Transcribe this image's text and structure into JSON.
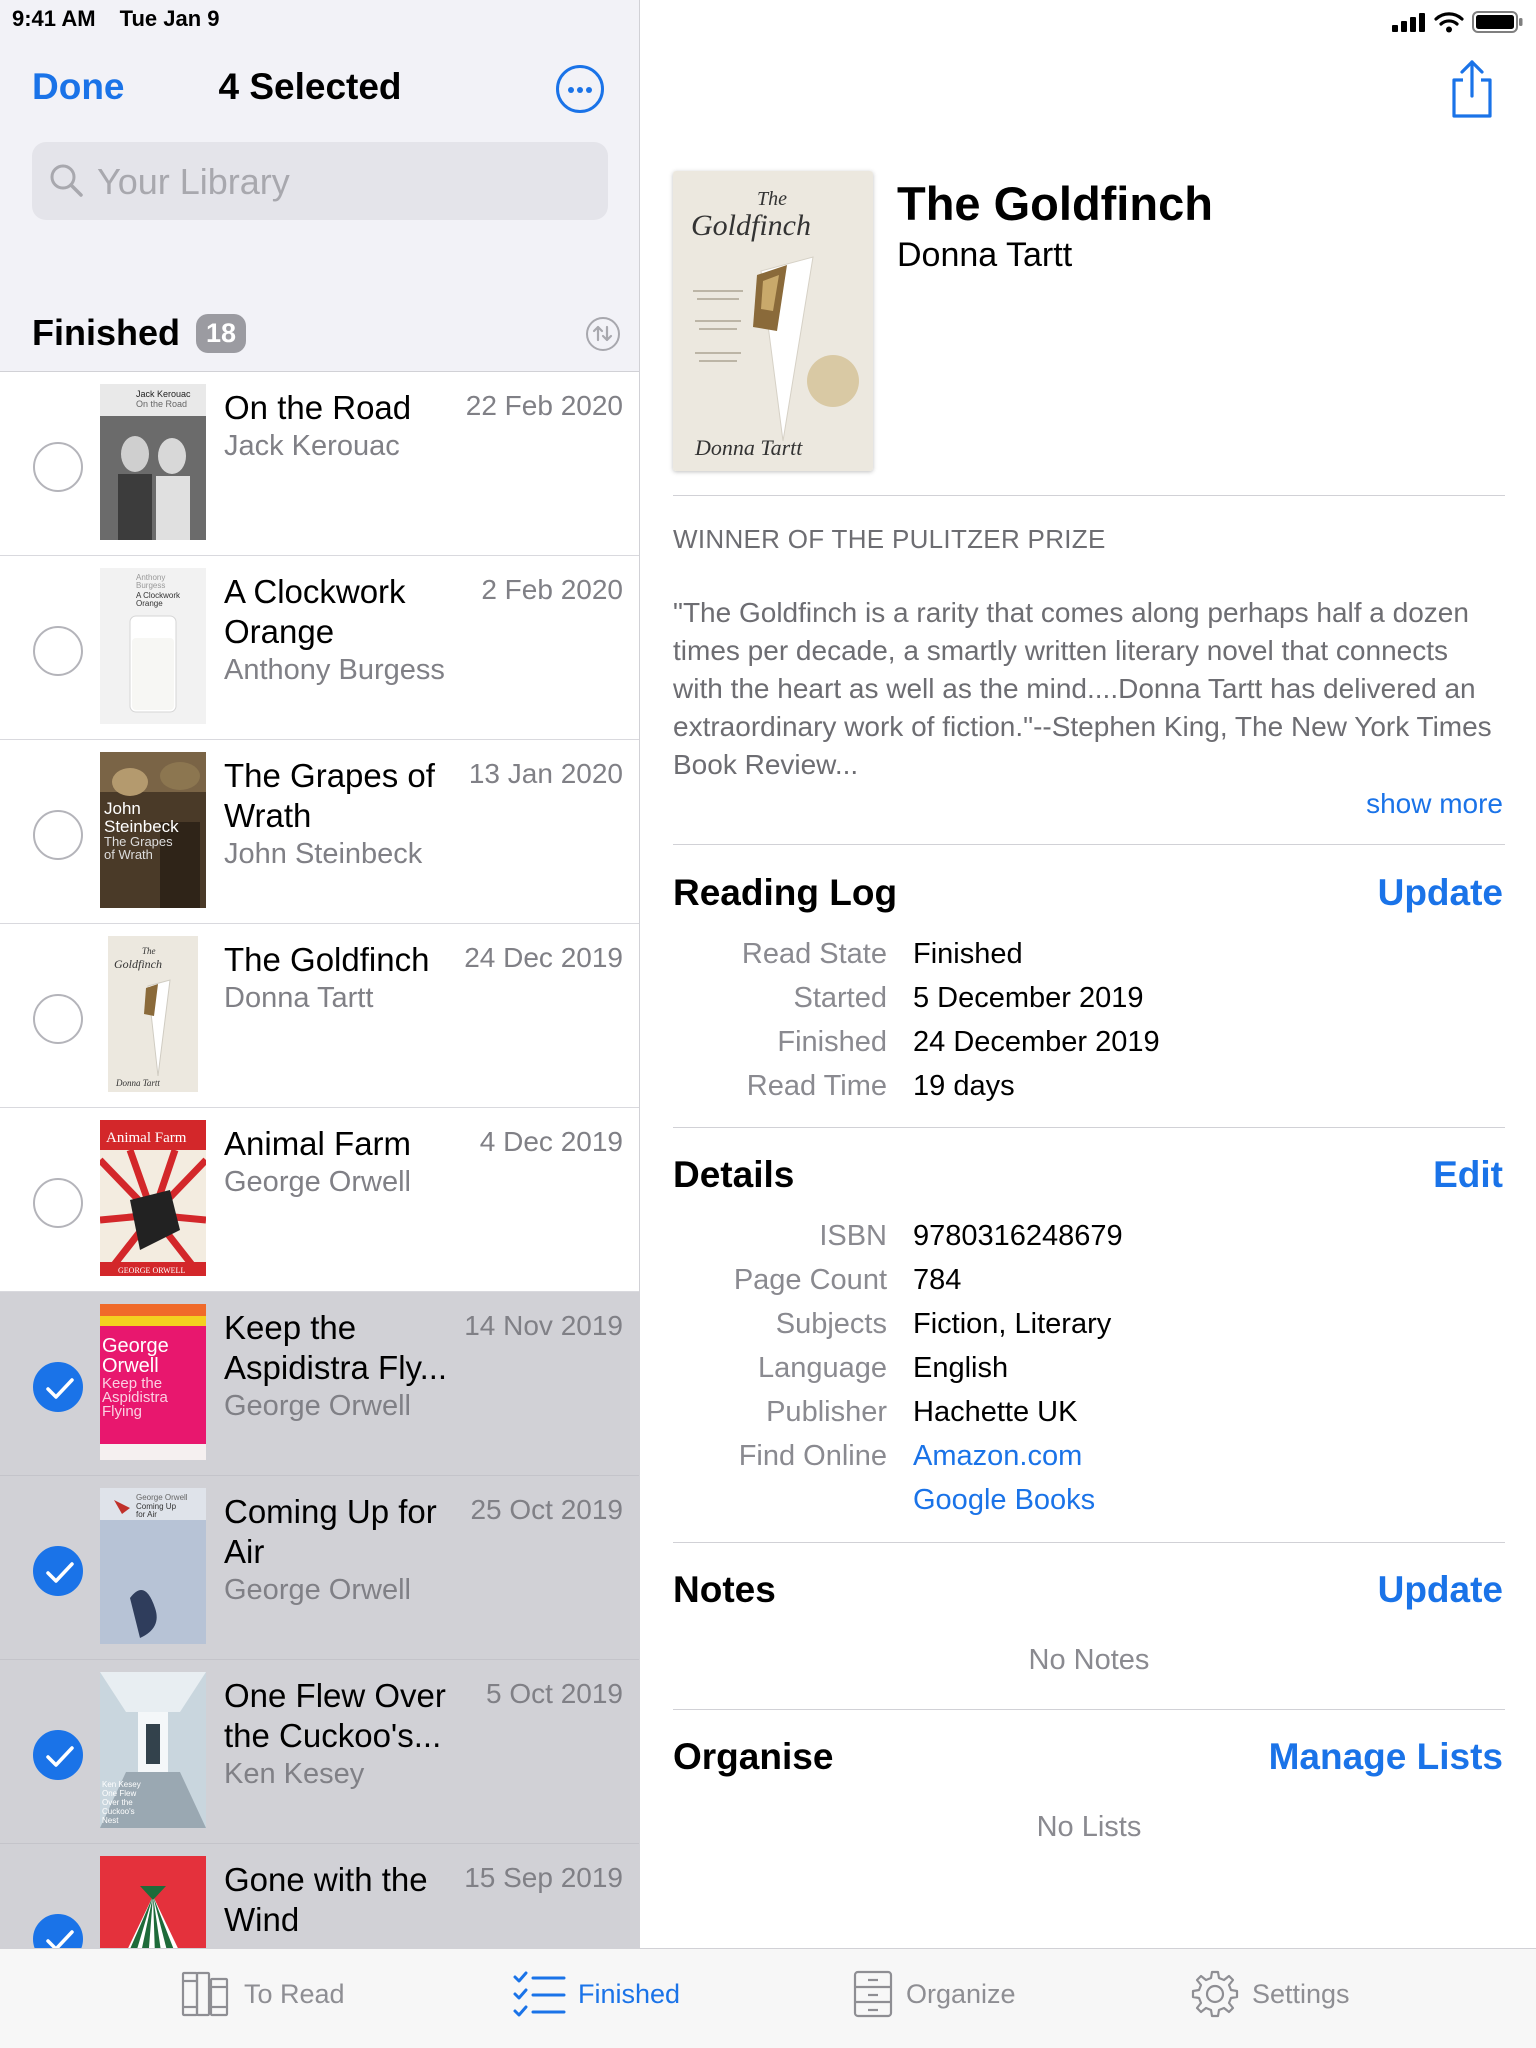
{
  "status": {
    "time": "9:41 AM",
    "date": "Tue Jan 9"
  },
  "nav": {
    "done_label": "Done",
    "title": "4 Selected",
    "more_icon": "ellipsis-circle-icon"
  },
  "search": {
    "placeholder": "Your Library"
  },
  "section": {
    "title": "Finished",
    "count": "18"
  },
  "books": [
    {
      "title": "On the Road",
      "author": "Jack Kerouac",
      "date": "22 Feb 2020",
      "selected": false
    },
    {
      "title": "A Clockwork Orange",
      "author": "Anthony Burgess",
      "date": "2 Feb 2020",
      "selected": false
    },
    {
      "title": "The Grapes of Wrath",
      "author": "John Steinbeck",
      "date": "13 Jan 2020",
      "selected": false
    },
    {
      "title": "The Goldfinch",
      "author": "Donna Tartt",
      "date": "24 Dec 2019",
      "selected": false
    },
    {
      "title": "Animal Farm",
      "author": "George Orwell",
      "date": "4 Dec 2019",
      "selected": false
    },
    {
      "title": "Keep the Aspidistra Fly...",
      "author": "George Orwell",
      "date": "14 Nov 2019",
      "selected": true
    },
    {
      "title": "Coming Up for Air",
      "author": "George Orwell",
      "date": "25 Oct 2019",
      "selected": true
    },
    {
      "title": "One Flew Over the Cuckoo's...",
      "author": "Ken Kesey",
      "date": "5 Oct 2019",
      "selected": true
    },
    {
      "title": "Gone with the Wind",
      "author": "",
      "date": "15 Sep 2019",
      "selected": true
    }
  ],
  "cover_text": {
    "on_the_road": [
      "Jack Kerouac",
      "On the Road"
    ],
    "clockwork": [
      "Anthony",
      "Burgess",
      "A Clockwork",
      "Orange"
    ],
    "grapes": [
      "John",
      "Steinbeck",
      "The Grapes",
      "of Wrath"
    ],
    "goldfinch": [
      "The",
      "Goldfinch",
      "Donna Tartt"
    ],
    "animal_farm": [
      "Animal Farm",
      "GEORGE ORWELL"
    ],
    "aspidistra": [
      "George",
      "Orwell",
      "Keep the",
      "Aspidistra",
      "Flying"
    ],
    "coming_up": [
      "George Orwell",
      "Coming Up",
      "for Air"
    ],
    "cuckoo": [
      "Ken Kesey",
      "One Flew",
      "Over the",
      "Cuckoo's",
      "Nest"
    ]
  },
  "detail": {
    "title": "The Goldfinch",
    "author": "Donna Tartt",
    "tagline": "WINNER OF THE PULITZER PRIZE",
    "blurb": "\"The Goldfinch is a rarity that comes along perhaps half a dozen times per decade, a smartly written literary novel that connects with the heart as well as the mind....Donna Tartt has delivered an extraordinary work of fiction.\"--Stephen King, The New York Times Book Review...",
    "show_more": "show more"
  },
  "reading_log": {
    "title": "Reading Log",
    "action": "Update",
    "rows": [
      {
        "key": "Read State",
        "value": "Finished"
      },
      {
        "key": "Started",
        "value": "5 December 2019"
      },
      {
        "key": "Finished",
        "value": "24 December 2019"
      },
      {
        "key": "Read Time",
        "value": "19 days"
      }
    ]
  },
  "details": {
    "title": "Details",
    "action": "Edit",
    "rows": [
      {
        "key": "ISBN",
        "value": "9780316248679"
      },
      {
        "key": "Page Count",
        "value": "784"
      },
      {
        "key": "Subjects",
        "value": "Fiction, Literary"
      },
      {
        "key": "Language",
        "value": "English"
      },
      {
        "key": "Publisher",
        "value": "Hachette UK"
      },
      {
        "key": "Find Online",
        "value": "Amazon.com"
      },
      {
        "key": "",
        "value": "Google Books"
      }
    ]
  },
  "notes": {
    "title": "Notes",
    "action": "Update",
    "empty": "No Notes"
  },
  "organise": {
    "title": "Organise",
    "action": "Manage Lists",
    "empty": "No Lists"
  },
  "tabs": [
    {
      "label": "To Read",
      "icon": "books-icon",
      "active": false
    },
    {
      "label": "Finished",
      "icon": "checklist-icon",
      "active": true
    },
    {
      "label": "Organize",
      "icon": "cabinet-icon",
      "active": false
    },
    {
      "label": "Settings",
      "icon": "gear-icon",
      "active": false
    }
  ],
  "colors": {
    "accent": "#1a73e8",
    "selected_row": "#d1d1d6",
    "sidebar_bg": "#f2f2f7"
  }
}
